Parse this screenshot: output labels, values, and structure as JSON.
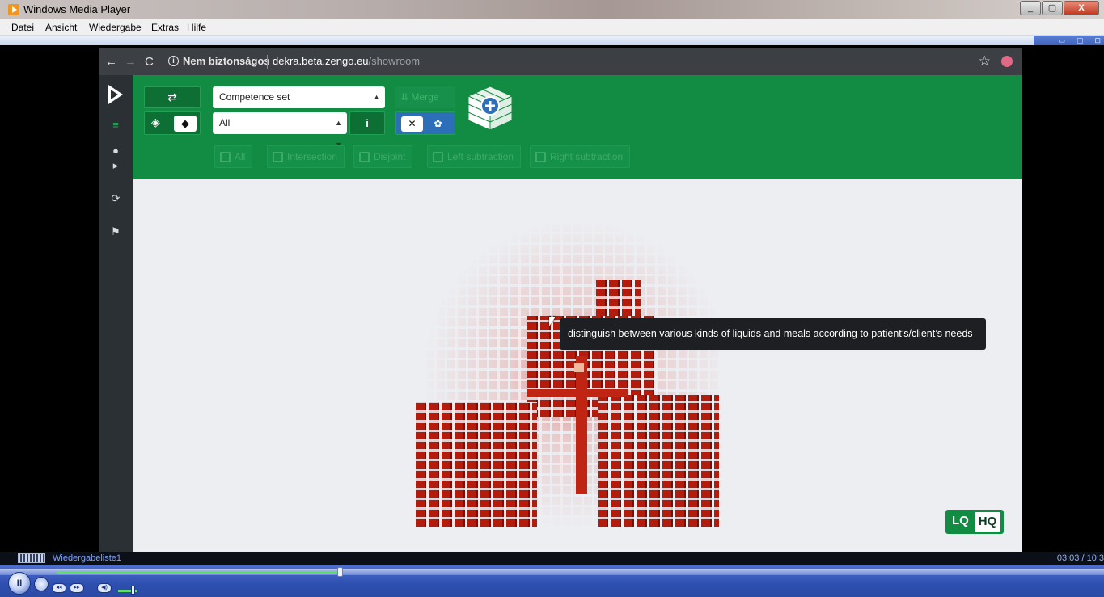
{
  "window": {
    "title": "Windows Media Player",
    "buttons": {
      "minimize": "_",
      "restore": "▢",
      "close": "X"
    }
  },
  "menubar": {
    "items": [
      "Datei",
      "Ansicht",
      "Wiedergabe",
      "Extras",
      "Hilfe"
    ]
  },
  "browser": {
    "security_label": "Nem biztonságos",
    "host": "dekra.beta.zengo.eu",
    "path": "/showroom"
  },
  "toolbar": {
    "competence_select": "Competence set",
    "filter_select": "All",
    "merge_label": "Merge",
    "set_operations": [
      "All",
      "Intersection",
      "Disjoint",
      "Left subtraction",
      "Right subtraction"
    ]
  },
  "tooltip": {
    "text": "distinguish between various kinds of liquids and meals according to patient’s/client’s needs"
  },
  "quality": {
    "lq": "LQ",
    "hq": "HQ",
    "selected": "HQ"
  },
  "player": {
    "playlist": "Wiedergabeliste1",
    "time": "03:03 / 10:3",
    "progress": 0.285
  },
  "colors": {
    "brand_green": "#138c43",
    "cube_red": "#b31b0c",
    "tooltip_bg": "#1d1f22",
    "sidebar": "#2b3034"
  },
  "icons": {
    "sidebar": [
      "logo-icon",
      "menu-icon",
      "user-icon",
      "logout-icon",
      "refresh-icon",
      "flag-icon"
    ],
    "toolbar": [
      "retweet-icon",
      "layers-icon",
      "cube-icon",
      "info-icon",
      "merge-icon",
      "palette-off-icon",
      "palette-icon"
    ]
  }
}
